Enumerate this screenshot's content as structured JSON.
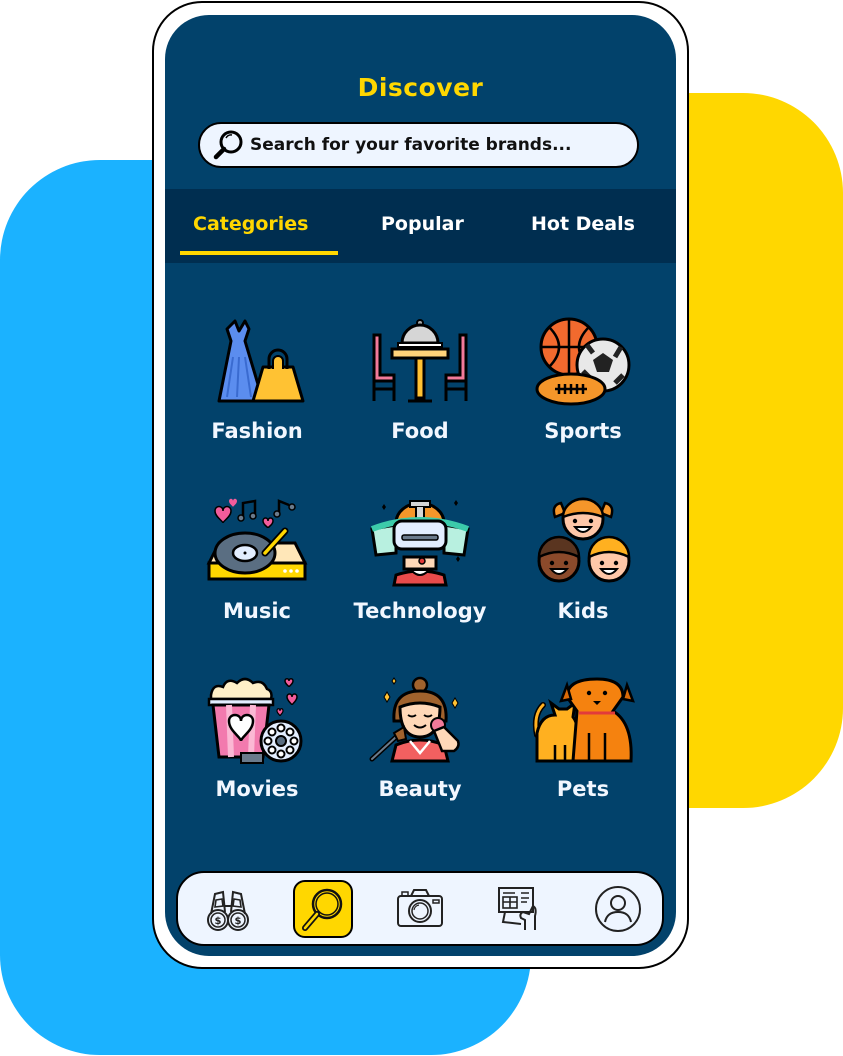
{
  "colors": {
    "accent": "#FFD700",
    "screen_bg": "#02426B",
    "tab_bar_bg": "#002E50",
    "backdrop_blue": "#1BB2FF",
    "backdrop_yellow": "#FFD700",
    "search_bg": "#EEF5FF"
  },
  "header": {
    "title": "Discover"
  },
  "search": {
    "icon": "search-icon",
    "placeholder": "Search for your favorite brands..."
  },
  "tabs": [
    {
      "label": "Categories",
      "active": true
    },
    {
      "label": "Popular",
      "active": false
    },
    {
      "label": "Hot Deals",
      "active": false
    }
  ],
  "categories": [
    {
      "label": "Fashion",
      "icon": "dress-and-handbag-icon"
    },
    {
      "label": "Food",
      "icon": "dining-table-icon"
    },
    {
      "label": "Sports",
      "icon": "sports-balls-icon"
    },
    {
      "label": "Music",
      "icon": "turntable-icon"
    },
    {
      "label": "Technology",
      "icon": "vr-headset-icon"
    },
    {
      "label": "Kids",
      "icon": "kids-faces-icon"
    },
    {
      "label": "Movies",
      "icon": "popcorn-film-icon"
    },
    {
      "label": "Beauty",
      "icon": "makeup-brush-icon"
    },
    {
      "label": "Pets",
      "icon": "cat-and-dog-icon"
    }
  ],
  "bottom_nav": [
    {
      "icon": "binoculars-dollar-icon",
      "active": false
    },
    {
      "icon": "search-icon",
      "active": true
    },
    {
      "icon": "camera-icon",
      "active": false
    },
    {
      "icon": "gift-card-icon",
      "active": false
    },
    {
      "icon": "user-profile-icon",
      "active": false
    }
  ]
}
